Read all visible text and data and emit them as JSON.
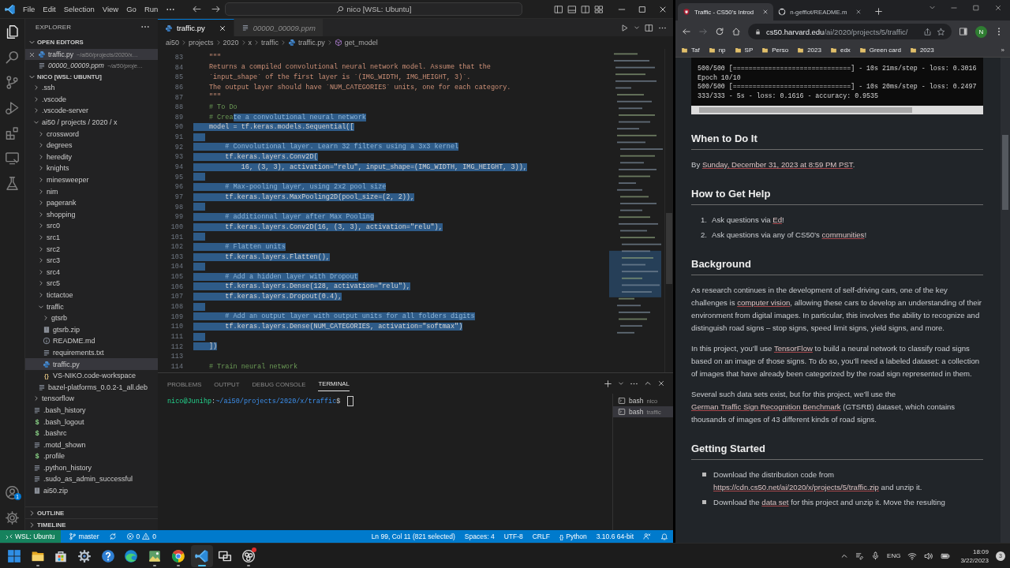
{
  "vscode": {
    "menu": [
      "File",
      "Edit",
      "Selection",
      "View",
      "Go",
      "Run"
    ],
    "command_center": "nico [WSL: Ubuntu]",
    "activity": [
      {
        "kind": "explorer",
        "selected": true
      },
      {
        "kind": "search",
        "selected": false
      },
      {
        "kind": "source_control",
        "selected": false
      },
      {
        "kind": "run_debug",
        "selected": false
      },
      {
        "kind": "extensions",
        "selected": false
      },
      {
        "kind": "remote",
        "selected": false
      },
      {
        "kind": "testing",
        "selected": false
      }
    ],
    "accounts_badge": "1",
    "sidebar": {
      "title": "EXPLORER",
      "open_editors": {
        "title": "OPEN EDITORS",
        "expanded": true,
        "items": [
          {
            "name": "traffic.py",
            "path": "~/ai50/projects/2020/x…",
            "kind": "python",
            "selected": true,
            "preview": false
          },
          {
            "name": "00000_00009.ppm",
            "path": "~/ai50/proje…",
            "kind": "text",
            "selected": false,
            "preview": true
          }
        ]
      },
      "workspace": {
        "title": "NICO [WSL: UBUNTU]",
        "expanded": true,
        "tree": [
          {
            "name": ".ssh",
            "kind": "folder",
            "expanded": false,
            "selected": false
          },
          {
            "name": ".vscode",
            "kind": "folder",
            "expanded": false,
            "selected": false
          },
          {
            "name": ".vscode-server",
            "kind": "folder",
            "expanded": false,
            "selected": false
          },
          {
            "name": "ai50 / projects / 2020 / x",
            "kind": "folder",
            "expanded": true,
            "selected": false,
            "children": [
              {
                "name": "crossword",
                "kind": "folder",
                "expanded": false,
                "selected": false
              },
              {
                "name": "degrees",
                "kind": "folder",
                "expanded": false,
                "selected": false
              },
              {
                "name": "heredity",
                "kind": "folder",
                "expanded": false,
                "selected": false
              },
              {
                "name": "knights",
                "kind": "folder",
                "expanded": false,
                "selected": false
              },
              {
                "name": "minesweeper",
                "kind": "folder",
                "expanded": false,
                "selected": false
              },
              {
                "name": "nim",
                "kind": "folder",
                "expanded": false,
                "selected": false
              },
              {
                "name": "pagerank",
                "kind": "folder",
                "expanded": false,
                "selected": false
              },
              {
                "name": "shopping",
                "kind": "folder",
                "expanded": false,
                "selected": false
              },
              {
                "name": "src0",
                "kind": "folder",
                "expanded": false,
                "selected": false
              },
              {
                "name": "src1",
                "kind": "folder",
                "expanded": false,
                "selected": false
              },
              {
                "name": "src2",
                "kind": "folder",
                "expanded": false,
                "selected": false
              },
              {
                "name": "src3",
                "kind": "folder",
                "expanded": false,
                "selected": false
              },
              {
                "name": "src4",
                "kind": "folder",
                "expanded": false,
                "selected": false
              },
              {
                "name": "src5",
                "kind": "folder",
                "expanded": false,
                "selected": false
              },
              {
                "name": "tictactoe",
                "kind": "folder",
                "expanded": false,
                "selected": false
              },
              {
                "name": "traffic",
                "kind": "folder",
                "expanded": true,
                "selected": false,
                "children": [
                  {
                    "name": "gtsrb",
                    "kind": "folder",
                    "expanded": false,
                    "selected": false
                  },
                  {
                    "name": "gtsrb.zip",
                    "kind": "zip",
                    "selected": false
                  },
                  {
                    "name": "README.md",
                    "kind": "info",
                    "selected": false
                  },
                  {
                    "name": "requirements.txt",
                    "kind": "text",
                    "selected": false
                  },
                  {
                    "name": "traffic.py",
                    "kind": "python",
                    "selected": true
                  },
                  {
                    "name": "VS-NIKO.code-workspace",
                    "kind": "workspace",
                    "icon": "{}",
                    "selected": false
                  }
                ]
              },
              {
                "name": "bazel-platforms_0.0.2-1_all.deb",
                "kind": "text",
                "selected": false
              }
            ]
          },
          {
            "name": "tensorflow",
            "kind": "folder",
            "expanded": false,
            "selected": false
          },
          {
            "name": ".bash_history",
            "kind": "text",
            "selected": false
          },
          {
            "name": ".bash_logout",
            "kind": "shell",
            "icon": "$",
            "selected": false
          },
          {
            "name": ".bashrc",
            "kind": "shell",
            "icon": "$",
            "selected": false
          },
          {
            "name": ".motd_shown",
            "kind": "text",
            "selected": false
          },
          {
            "name": ".profile",
            "kind": "shell",
            "icon": "$",
            "selected": false
          },
          {
            "name": ".python_history",
            "kind": "text",
            "selected": false
          },
          {
            "name": ".sudo_as_admin_successful",
            "kind": "text",
            "selected": false
          },
          {
            "name": "ai50.zip",
            "kind": "zip",
            "selected": false
          }
        ]
      },
      "sections": [
        {
          "title": "OUTLINE",
          "expanded": false
        },
        {
          "title": "TIMELINE",
          "expanded": false
        }
      ]
    },
    "editor": {
      "tabs": [
        {
          "label": "traffic.py",
          "kind": "python",
          "selected": true,
          "preview": false
        },
        {
          "label": "00000_00009.ppm",
          "kind": "text",
          "selected": false,
          "preview": true
        }
      ],
      "breadcrumbs": [
        {
          "label": "ai50",
          "kind": "folder"
        },
        {
          "label": "projects",
          "kind": "folder"
        },
        {
          "label": "2020",
          "kind": "folder"
        },
        {
          "label": "x",
          "kind": "folder"
        },
        {
          "label": "traffic",
          "kind": "folder"
        },
        {
          "label": "traffic.py",
          "kind": "python"
        },
        {
          "label": "get_model",
          "kind": "method"
        }
      ],
      "lines": [
        {
          "number": "83",
          "kind": "docstring",
          "text": "    \"\"\"",
          "selected": false
        },
        {
          "number": "84",
          "kind": "docstring",
          "text": "    Returns a compiled convolutional neural network model. Assume that the",
          "selected": false
        },
        {
          "number": "85",
          "kind": "docstring",
          "text": "    `input_shape` of the first layer is `(IMG_WIDTH, IMG_HEIGHT, 3)`.",
          "selected": false
        },
        {
          "number": "86",
          "kind": "docstring",
          "text": "    The output layer should have `NUM_CATEGORIES` units, one for each category.",
          "selected": false
        },
        {
          "number": "87",
          "kind": "docstring",
          "text": "    \"\"\"",
          "selected": false
        },
        {
          "number": "88",
          "kind": "comment",
          "text": "    # To Do",
          "selected": false
        },
        {
          "number": "89",
          "kind": "comment",
          "text": "    # Crea",
          "selected_text": "te a convolutional neural network",
          "selected": true
        },
        {
          "number": "90",
          "kind": "code",
          "text": "    model = tf.keras.models.Sequential([",
          "selected": true
        },
        {
          "number": "91",
          "kind": "blank",
          "selected": true
        },
        {
          "number": "92",
          "kind": "comment",
          "text": "        # Convolutional layer. Learn 32 filters using a 3x3 kernel",
          "selected": true
        },
        {
          "number": "93",
          "kind": "code",
          "text": "        tf.keras.layers.Conv2D(",
          "selected": true
        },
        {
          "number": "94",
          "kind": "code",
          "text": "            16, (3, 3), activation=\"relu\", input_shape=(IMG_WIDTH, IMG_HEIGHT, 3)),",
          "selected": true
        },
        {
          "number": "95",
          "kind": "blank",
          "selected": true
        },
        {
          "number": "96",
          "kind": "comment",
          "text": "        # Max-pooling layer, using 2x2 pool size",
          "selected": true
        },
        {
          "number": "97",
          "kind": "code",
          "text": "        tf.keras.layers.MaxPooling2D(pool_size=(2, 2)),",
          "selected": true
        },
        {
          "number": "98",
          "kind": "blank",
          "selected": true
        },
        {
          "number": "99",
          "kind": "comment",
          "text": "        # additionnal layer after Max Pooling",
          "selected": true
        },
        {
          "number": "100",
          "kind": "code",
          "text": "        tf.keras.layers.Conv2D(16, (3, 3), activation=\"relu\"),",
          "selected": true
        },
        {
          "number": "101",
          "kind": "blank",
          "selected": true
        },
        {
          "number": "102",
          "kind": "comment",
          "text": "        # Flatten units",
          "selected": true
        },
        {
          "number": "103",
          "kind": "code",
          "text": "        tf.keras.layers.Flatten(),",
          "selected": true
        },
        {
          "number": "104",
          "kind": "blank",
          "selected": true
        },
        {
          "number": "105",
          "kind": "comment",
          "text": "        # Add a hidden layer with Dropout",
          "selected": true
        },
        {
          "number": "106",
          "kind": "code",
          "text": "        tf.keras.layers.Dense(128, activation=\"relu\"),",
          "selected": true
        },
        {
          "number": "107",
          "kind": "code",
          "text": "        tf.keras.layers.Dropout(0.4),",
          "selected": true
        },
        {
          "number": "108",
          "kind": "blank",
          "selected": true
        },
        {
          "number": "109",
          "kind": "comment",
          "text": "        # Add an output layer with output units for all folders digits",
          "selected": true
        },
        {
          "number": "110",
          "kind": "code",
          "text": "        tf.keras.layers.Dense(NUM_CATEGORIES, activation=\"softmax\")",
          "selected": true
        },
        {
          "number": "111",
          "kind": "blank",
          "selected": true
        },
        {
          "number": "112",
          "kind": "code",
          "text": "    ])",
          "selected": true
        },
        {
          "number": "113",
          "kind": "blank",
          "selected": false
        },
        {
          "number": "114",
          "kind": "comment",
          "text": "    # Train neural network",
          "selected": false
        }
      ]
    },
    "panel": {
      "tabs": [
        {
          "label": "PROBLEMS",
          "selected": false
        },
        {
          "label": "OUTPUT",
          "selected": false
        },
        {
          "label": "DEBUG CONSOLE",
          "selected": false
        },
        {
          "label": "TERMINAL",
          "selected": true
        }
      ],
      "prompt": {
        "user": "nico@Junihp",
        "separator": ":",
        "path": "~/ai50/projects/2020/x/traffic",
        "symbol": "$"
      },
      "terminals": [
        {
          "name": "bash",
          "detail": "nico",
          "selected": false
        },
        {
          "name": "bash",
          "detail": "traffic",
          "selected": true
        }
      ]
    },
    "status": {
      "remote": "WSL: Ubuntu",
      "branch": "master",
      "errors": "0",
      "warnings": "0",
      "items": [
        {
          "kind": "text",
          "text": "Ln 99, Col 11 (821 selected)"
        },
        {
          "kind": "text",
          "text": "Spaces: 4"
        },
        {
          "kind": "text",
          "text": "UTF-8"
        },
        {
          "kind": "text",
          "text": "CRLF"
        },
        {
          "kind": "language",
          "icon": "{}",
          "text": "Python"
        },
        {
          "kind": "text",
          "text": "3.10.6 64-bit"
        }
      ]
    }
  },
  "browser": {
    "tabs": [
      {
        "title": "Traffic - CS50's Introd",
        "kind": "shield",
        "selected": true
      },
      {
        "title": "n-gefflot/README.m",
        "kind": "site",
        "selected": false
      }
    ],
    "address": {
      "host": "cs50.harvard.edu",
      "path": "/ai/2020/projects/5/traffic/"
    },
    "profile": "N",
    "bookmarks": [
      "Taf",
      "np",
      "SP",
      "Perso",
      "2023",
      "edx",
      "Green card",
      "2023"
    ],
    "bookmarks_more": "»",
    "page": {
      "output_lines": [
        "500/500 [==============================] - 10s 21ms/step - loss: 0.3016",
        "Epoch 10/10",
        "500/500 [==============================] - 10s 20ms/step - loss: 0.2497",
        "333/333 - 5s - loss: 0.1616 - accuracy: 0.9535"
      ],
      "sections": [
        {
          "heading": "When to Do It",
          "blocks": [
            {
              "kind": "paragraph",
              "parts": [
                {
                  "kind": "text",
                  "text": "By "
                },
                {
                  "kind": "link",
                  "text": "Sunday, December 31, 2023 at 8:59 PM PST"
                },
                {
                  "kind": "text",
                  "text": "."
                }
              ]
            }
          ]
        },
        {
          "heading": "How to Get Help",
          "blocks": [
            {
              "kind": "ordered",
              "items": [
                {
                  "marker": "1.",
                  "parts": [
                    {
                      "kind": "text",
                      "text": "Ask questions via "
                    },
                    {
                      "kind": "link",
                      "text": "Ed"
                    },
                    {
                      "kind": "text",
                      "text": "!"
                    }
                  ]
                },
                {
                  "marker": "2.",
                  "parts": [
                    {
                      "kind": "text",
                      "text": "Ask questions via any of CS50’s "
                    },
                    {
                      "kind": "link",
                      "text": "communities"
                    },
                    {
                      "kind": "text",
                      "text": "!"
                    }
                  ]
                }
              ]
            }
          ]
        },
        {
          "heading": "Background",
          "blocks": [
            {
              "kind": "paragraph",
              "parts": [
                {
                  "kind": "text",
                  "text": "As research continues in the development of self-driving cars, one of the key challenges is "
                },
                {
                  "kind": "link",
                  "text": "computer vision"
                },
                {
                  "kind": "text",
                  "text": ", allowing these cars to develop an understanding of their environment from digital images. In particular, this involves the ability to recognize and distinguish road signs – stop signs, speed limit signs, yield signs, and more."
                }
              ]
            },
            {
              "kind": "paragraph",
              "parts": [
                {
                  "kind": "text",
                  "text": "In this project, you’ll use "
                },
                {
                  "kind": "link",
                  "text": "TensorFlow"
                },
                {
                  "kind": "text",
                  "text": " to build a neural network to classify road signs based on an image of those signs. To do so, you’ll need a labeled dataset: a collection of images that have already been categorized by the road sign represented in them."
                }
              ]
            },
            {
              "kind": "paragraph",
              "parts": [
                {
                  "kind": "text",
                  "text": "Several such data sets exist, but for this project, we’ll use the "
                },
                {
                  "kind": "link",
                  "text": "German Traffic Sign Recognition Benchmark"
                },
                {
                  "kind": "text",
                  "text": " (GTSRB) dataset, which contains thousands of images of 43 different kinds of road signs."
                }
              ]
            }
          ]
        },
        {
          "heading": "Getting Started",
          "blocks": [
            {
              "kind": "bulleted",
              "items": [
                {
                  "parts": [
                    {
                      "kind": "text",
                      "text": "Download the distribution code from "
                    },
                    {
                      "kind": "link",
                      "text": "https://cdn.cs50.net/ai/2020/x/projects/5/traffic.zip"
                    },
                    {
                      "kind": "text",
                      "text": " and unzip it."
                    }
                  ]
                },
                {
                  "parts": [
                    {
                      "kind": "text",
                      "text": "Download the "
                    },
                    {
                      "kind": "link",
                      "text": "data set"
                    },
                    {
                      "kind": "text",
                      "text": " for this project and unzip it. Move the resulting"
                    }
                  ]
                }
              ]
            }
          ]
        }
      ]
    }
  },
  "taskbar": {
    "apps": [
      {
        "kind": "start",
        "running": false,
        "selected": false,
        "alert": false
      },
      {
        "kind": "folder",
        "running": true,
        "selected": false,
        "alert": false
      },
      {
        "kind": "store",
        "running": false,
        "selected": false,
        "alert": false
      },
      {
        "kind": "settings",
        "running": false,
        "selected": false,
        "alert": false
      },
      {
        "kind": "help",
        "running": false,
        "selected": false,
        "alert": false
      },
      {
        "kind": "edge",
        "running": false,
        "selected": false,
        "alert": false
      },
      {
        "kind": "image",
        "running": true,
        "selected": false,
        "alert": false
      },
      {
        "kind": "chrome",
        "running": true,
        "selected": false,
        "alert": false
      },
      {
        "kind": "vscode",
        "running": true,
        "selected": true,
        "alert": false
      },
      {
        "kind": "screens",
        "running": false,
        "selected": false,
        "alert": false
      },
      {
        "kind": "obs",
        "running": true,
        "selected": false,
        "alert": true
      }
    ],
    "language": "ENG",
    "time": "18:09",
    "date": "3/22/2023",
    "notifications": "3"
  }
}
